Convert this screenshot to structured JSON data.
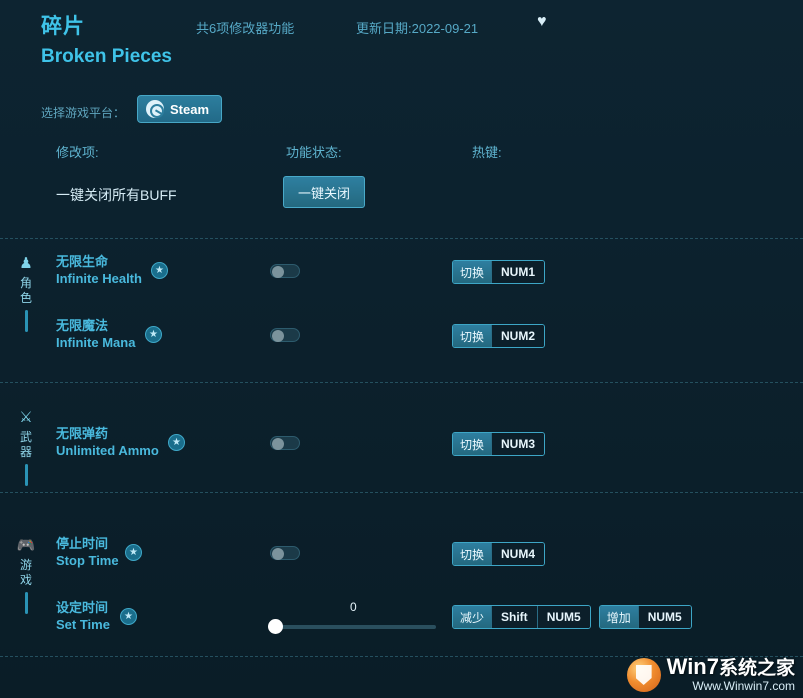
{
  "header": {
    "title_cn": "碎片",
    "title_en": "Broken Pieces",
    "feature_count": "共6项修改器功能",
    "update_date": "更新日期:2022-09-21",
    "favorite_icon": "♥"
  },
  "platform": {
    "label": "选择游戏平台：",
    "selected": "Steam",
    "icon": "steam-icon"
  },
  "columns": {
    "mod_item": "修改项:",
    "status": "功能状态:",
    "hotkey": "热键:"
  },
  "master": {
    "label": "一键关闭所有BUFF",
    "button": "一键关闭"
  },
  "groups": [
    {
      "icon": "♟",
      "name": "角色",
      "rows": [
        {
          "name_cn": "无限生命",
          "name_en": "Infinite Health",
          "star": "★",
          "control": "toggle",
          "toggle_on": false,
          "hotkeys": [
            {
              "action": "切换",
              "key": "NUM1"
            }
          ]
        },
        {
          "name_cn": "无限魔法",
          "name_en": "Infinite Mana",
          "star": "★",
          "control": "toggle",
          "toggle_on": false,
          "hotkeys": [
            {
              "action": "切换",
              "key": "NUM2"
            }
          ]
        }
      ]
    },
    {
      "icon": "⚔",
      "name": "武器",
      "rows": [
        {
          "name_cn": "无限弹药",
          "name_en": "Unlimited Ammo",
          "star": "★",
          "control": "toggle",
          "toggle_on": false,
          "hotkeys": [
            {
              "action": "切换",
              "key": "NUM3"
            }
          ]
        }
      ]
    },
    {
      "icon": "🎮",
      "name": "游戏",
      "rows": [
        {
          "name_cn": "停止时间",
          "name_en": "Stop Time",
          "star": "★",
          "control": "toggle",
          "toggle_on": false,
          "hotkeys": [
            {
              "action": "切换",
              "key": "NUM4"
            }
          ]
        },
        {
          "name_cn": "设定时间",
          "name_en": "Set Time",
          "star": "★",
          "control": "slider",
          "slider_value": "0",
          "slider_percent": 0,
          "hotkeys": [
            {
              "action": "减少",
              "key": "Shift",
              "key2": "NUM5"
            },
            {
              "action": "增加",
              "key": "NUM5"
            }
          ]
        }
      ]
    }
  ],
  "watermark": {
    "main_left": "Win7",
    "main_right": "系统之家",
    "sub": "Www.Winwin7.com"
  },
  "colors": {
    "accent": "#3fc3e8",
    "background": "#0b1f2a",
    "button": "#2d7e9e",
    "text": "#cfe8f2"
  }
}
